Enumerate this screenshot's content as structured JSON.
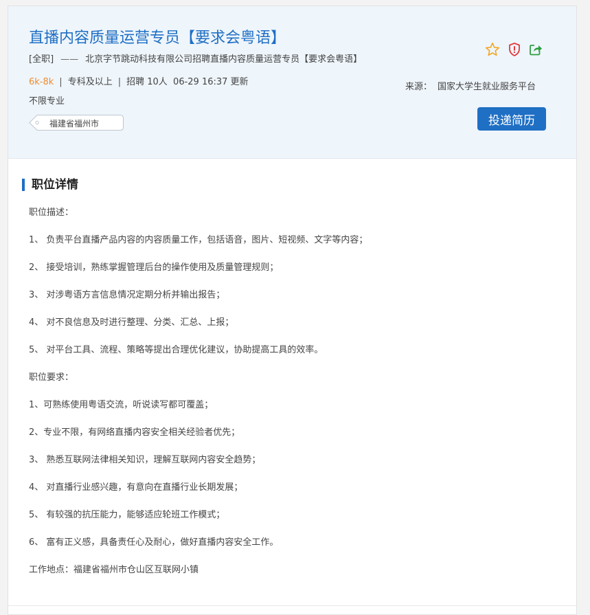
{
  "job": {
    "title": "直播内容质量运营专员【要求会粤语】",
    "type": "[全职]",
    "dash": "——",
    "company_line": "北京字节跳动科技有限公司招聘直播内容质量运营专员【要求会粤语】",
    "salary": "6k-8k",
    "education": "专科及以上",
    "headcount": "招聘 10人",
    "updated": "06-29 16:37 更新",
    "separator": "|",
    "major": "不限专业",
    "location_tag": "福建省福州市",
    "source_label": "来源：",
    "source_value": "国家大学生就业服务平台",
    "apply_label": "投递简历"
  },
  "icons": [
    "star-icon",
    "shield-alert-icon",
    "share-icon"
  ],
  "colors": {
    "accent": "#1f6fc4",
    "salary": "#f08c2e",
    "star": "#f5a623",
    "shield": "#e23b3b",
    "share": "#2e9e3f"
  },
  "details": {
    "heading": "职位详情",
    "paragraphs": [
      "职位描述：",
      "1、 负责平台直播产品内容的内容质量工作，包括语音，图片、短视频、文字等内容；",
      "2、 接受培训，熟练掌握管理后台的操作使用及质量管理规则；",
      "3、 对涉粤语方言信息情况定期分析并输出报告；",
      "4、 对不良信息及时进行整理、分类、汇总、上报；",
      "5、 对平台工具、流程、策略等提出合理优化建议，协助提高工具的效率。",
      "职位要求：",
      "1、可熟练使用粤语交流，听说读写都可覆盖；",
      "2、专业不限，有网络直播内容安全相关经验者优先；",
      "3、 熟悉互联网法律相关知识，理解互联网内容安全趋势；",
      "4、 对直播行业感兴趣，有意向在直播行业长期发展；",
      "5、 有较强的抗压能力，能够适应轮班工作模式；",
      "6、 富有正义感，具备责任心及耐心，做好直播内容安全工作。",
      "工作地点：福建省福州市仓山区互联网小镇"
    ]
  }
}
